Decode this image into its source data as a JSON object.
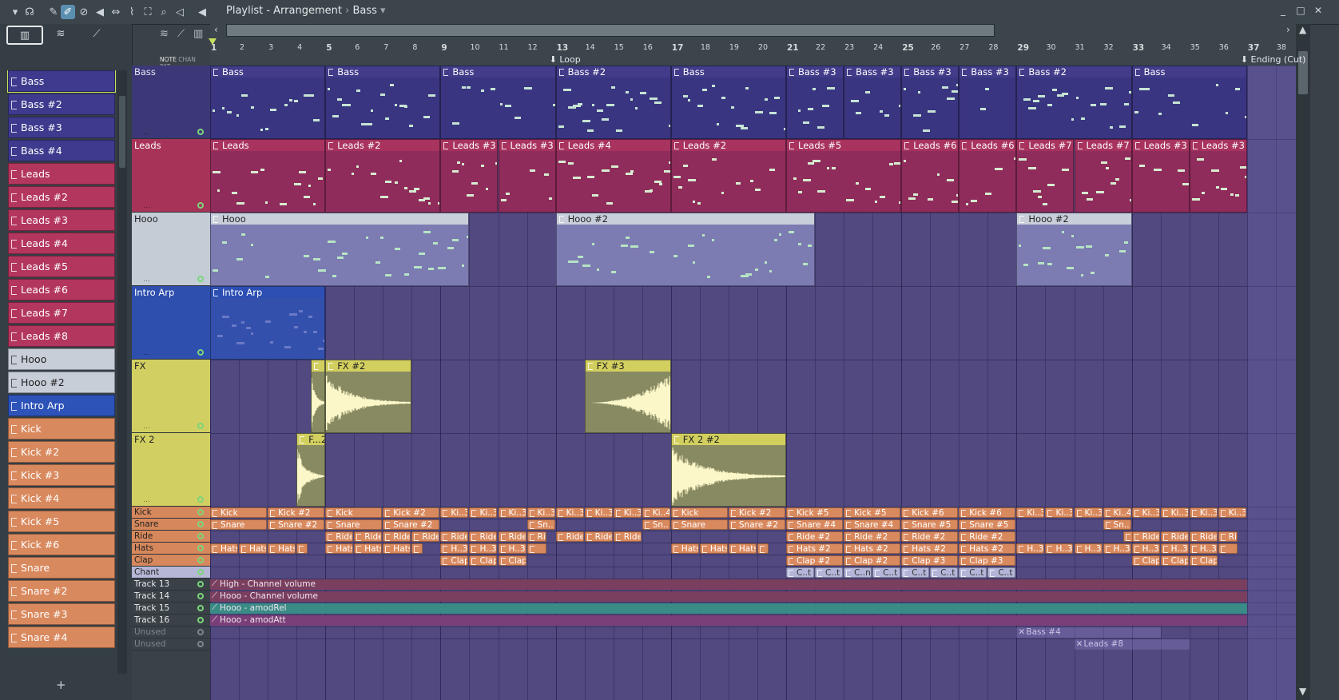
{
  "window": {
    "title": "Playlist - Arrangement",
    "pattern_selector": "Bass",
    "sep": "›"
  },
  "browser": {
    "tab_labels": [
      "NOTE",
      "CHAN",
      "PAT"
    ],
    "patterns": [
      {
        "label": "Bass",
        "color": "#3e3b8e",
        "selected": true
      },
      {
        "label": "Bass #2",
        "color": "#3e3b8e"
      },
      {
        "label": "Bass #3",
        "color": "#3e3b8e"
      },
      {
        "label": "Bass #4",
        "color": "#3e3b8e"
      },
      {
        "label": "Leads",
        "color": "#b3365f"
      },
      {
        "label": "Leads #2",
        "color": "#b3365f"
      },
      {
        "label": "Leads #3",
        "color": "#b3365f"
      },
      {
        "label": "Leads #4",
        "color": "#b3365f"
      },
      {
        "label": "Leads #5",
        "color": "#b3365f"
      },
      {
        "label": "Leads #6",
        "color": "#b3365f"
      },
      {
        "label": "Leads #7",
        "color": "#b3365f"
      },
      {
        "label": "Leads #8",
        "color": "#b3365f"
      },
      {
        "label": "Hooo",
        "color": "#c7ced8"
      },
      {
        "label": "Hooo #2",
        "color": "#c7ced8"
      },
      {
        "label": "Intro Arp",
        "color": "#2d53b8"
      },
      {
        "label": "Kick",
        "color": "#d9895e"
      },
      {
        "label": "Kick #2",
        "color": "#d9895e"
      },
      {
        "label": "Kick #3",
        "color": "#d9895e"
      },
      {
        "label": "Kick #4",
        "color": "#d9895e"
      },
      {
        "label": "Kick #5",
        "color": "#d9895e"
      },
      {
        "label": "Kick #6",
        "color": "#d9895e"
      },
      {
        "label": "Snare",
        "color": "#d9895e"
      },
      {
        "label": "Snare #2",
        "color": "#d9895e"
      },
      {
        "label": "Snare #3",
        "color": "#d9895e"
      },
      {
        "label": "Snare #4",
        "color": "#d9895e"
      }
    ]
  },
  "timeline": {
    "bars": [
      "1",
      "2",
      "3",
      "4",
      "5",
      "6",
      "7",
      "8",
      "9",
      "10",
      "11",
      "12",
      "13",
      "14",
      "15",
      "16",
      "17",
      "18",
      "19",
      "20",
      "21",
      "22",
      "23",
      "24",
      "25",
      "26",
      "27",
      "28",
      "29",
      "30",
      "31",
      "32",
      "33",
      "34",
      "35",
      "36",
      "37",
      "38"
    ],
    "markers": [
      {
        "label": "Loop",
        "bar": 13
      },
      {
        "label": "Ending (Cut)",
        "bar": 37
      }
    ]
  },
  "tracks": [
    {
      "name": "Bass",
      "color": "#3c3878",
      "text": "#e6e6f2"
    },
    {
      "name": "Leads",
      "color": "#a83358",
      "text": "#ffffff"
    },
    {
      "name": "Hooo",
      "color": "#c4ccd6",
      "text": "#222"
    },
    {
      "name": "Intro Arp",
      "color": "#2e4fae",
      "text": "#ffffff"
    },
    {
      "name": "FX",
      "color": "#d2cf62",
      "text": "#222"
    },
    {
      "name": "FX  2",
      "color": "#d2cf62",
      "text": "#222"
    },
    {
      "name": "Kick",
      "color": "#d6885c",
      "text": "#222"
    },
    {
      "name": "Snare",
      "color": "#d6885c",
      "text": "#222"
    },
    {
      "name": "Ride",
      "color": "#d6885c",
      "text": "#222"
    },
    {
      "name": "Hats",
      "color": "#d6885c",
      "text": "#222"
    },
    {
      "name": "Clap",
      "color": "#d6885c",
      "text": "#222"
    },
    {
      "name": "Chant",
      "color": "#b6b7d6",
      "text": "#222"
    },
    {
      "name": "Track 13",
      "color": "#3a4248",
      "text": "#e6e9eb"
    },
    {
      "name": "Track 14",
      "color": "#3a4248",
      "text": "#e6e9eb"
    },
    {
      "name": "Track 15",
      "color": "#3a4248",
      "text": "#e6e9eb"
    },
    {
      "name": "Track 16",
      "color": "#3a4248",
      "text": "#e6e9eb"
    },
    {
      "name": "Unused",
      "color": "#3a4248",
      "text": "#7d868b"
    },
    {
      "name": "Unused",
      "color": "#3a4248",
      "text": "#7d868b"
    }
  ],
  "clips": {
    "bass": [
      {
        "label": "Bass",
        "start": 1,
        "len": 4
      },
      {
        "label": "Bass",
        "start": 5,
        "len": 4
      },
      {
        "label": "Bass",
        "start": 9,
        "len": 4
      },
      {
        "label": "Bass #2",
        "start": 13,
        "len": 4
      },
      {
        "label": "Bass",
        "start": 17,
        "len": 4
      },
      {
        "label": "Bass #3",
        "start": 21,
        "len": 2
      },
      {
        "label": "Bass #3",
        "start": 23,
        "len": 2
      },
      {
        "label": "Bass #3",
        "start": 25,
        "len": 2
      },
      {
        "label": "Bass #3",
        "start": 27,
        "len": 2
      },
      {
        "label": "Bass #2",
        "start": 29,
        "len": 4
      },
      {
        "label": "Bass",
        "start": 33,
        "len": 4
      }
    ],
    "leads": [
      {
        "label": "Leads",
        "start": 1,
        "len": 4
      },
      {
        "label": "Leads #2",
        "start": 5,
        "len": 4
      },
      {
        "label": "Leads #3",
        "start": 9,
        "len": 2
      },
      {
        "label": "Leads #3",
        "start": 11,
        "len": 2
      },
      {
        "label": "Leads #4",
        "start": 13,
        "len": 4
      },
      {
        "label": "Leads #2",
        "start": 17,
        "len": 4
      },
      {
        "label": "Leads #5",
        "start": 21,
        "len": 4
      },
      {
        "label": "Leads #6",
        "start": 25,
        "len": 2
      },
      {
        "label": "Leads #6",
        "start": 27,
        "len": 2
      },
      {
        "label": "Leads #7",
        "start": 29,
        "len": 2
      },
      {
        "label": "Leads #7",
        "start": 31,
        "len": 2
      },
      {
        "label": "Leads #3",
        "start": 33,
        "len": 2
      },
      {
        "label": "Leads #3",
        "start": 35,
        "len": 2
      }
    ],
    "hooo": [
      {
        "label": "Hooo",
        "start": 1,
        "len": 9
      },
      {
        "label": "Hooo #2",
        "start": 13,
        "len": 9
      },
      {
        "label": "Hooo #2",
        "start": 29,
        "len": 4
      }
    ],
    "arp": [
      {
        "label": "Intro Arp",
        "start": 1,
        "len": 4
      }
    ],
    "fx": [
      {
        "label": "",
        "start": 4.5,
        "len": 0.5
      },
      {
        "label": "FX #2",
        "start": 5,
        "len": 3
      },
      {
        "label": "FX #3",
        "start": 14,
        "len": 3
      }
    ],
    "fx2": [
      {
        "label": "F...2",
        "start": 4,
        "len": 1
      },
      {
        "label": "FX  2 #2",
        "start": 17,
        "len": 4
      }
    ],
    "kick": [
      {
        "label": "Kick",
        "start": 1,
        "len": 2
      },
      {
        "label": "Kick #2",
        "start": 3,
        "len": 2
      },
      {
        "label": "Kick",
        "start": 5,
        "len": 2
      },
      {
        "label": "Kick #2",
        "start": 7,
        "len": 2
      },
      {
        "label": "Ki..3",
        "start": 9,
        "len": 1
      },
      {
        "label": "Ki..3",
        "start": 10,
        "len": 1
      },
      {
        "label": "Ki..3",
        "start": 11,
        "len": 1
      },
      {
        "label": "Ki..3",
        "start": 12,
        "len": 1
      },
      {
        "label": "Ki..3",
        "start": 13,
        "len": 1
      },
      {
        "label": "Ki..3",
        "start": 14,
        "len": 1
      },
      {
        "label": "Ki..3",
        "start": 15,
        "len": 1
      },
      {
        "label": "Ki..4",
        "start": 16,
        "len": 1
      },
      {
        "label": "Kick",
        "start": 17,
        "len": 2
      },
      {
        "label": "Kick #2",
        "start": 19,
        "len": 2
      },
      {
        "label": "Kick #5",
        "start": 21,
        "len": 2
      },
      {
        "label": "Kick #5",
        "start": 23,
        "len": 2
      },
      {
        "label": "Kick #6",
        "start": 25,
        "len": 2
      },
      {
        "label": "Kick #6",
        "start": 27,
        "len": 2
      },
      {
        "label": "Ki..3",
        "start": 29,
        "len": 1
      },
      {
        "label": "Ki..3",
        "start": 30,
        "len": 1
      },
      {
        "label": "Ki..3",
        "start": 31,
        "len": 1
      },
      {
        "label": "Ki..4",
        "start": 32,
        "len": 1
      },
      {
        "label": "Ki..3",
        "start": 33,
        "len": 1
      },
      {
        "label": "Ki..3",
        "start": 34,
        "len": 1
      },
      {
        "label": "Ki..3",
        "start": 35,
        "len": 1
      },
      {
        "label": "Ki..3",
        "start": 36,
        "len": 1
      }
    ],
    "snare": [
      {
        "label": "Snare",
        "start": 1,
        "len": 2
      },
      {
        "label": "Snare #2",
        "start": 3,
        "len": 2
      },
      {
        "label": "Snare",
        "start": 5,
        "len": 2
      },
      {
        "label": "Snare #2",
        "start": 7,
        "len": 2
      },
      {
        "label": "Sn..",
        "start": 12,
        "len": 1
      },
      {
        "label": "Sn..",
        "start": 16,
        "len": 1
      },
      {
        "label": "Snare",
        "start": 17,
        "len": 2
      },
      {
        "label": "Snare #2",
        "start": 19,
        "len": 2
      },
      {
        "label": "Snare #4",
        "start": 21,
        "len": 2
      },
      {
        "label": "Snare #4",
        "start": 23,
        "len": 2
      },
      {
        "label": "Snare #5",
        "start": 25,
        "len": 2
      },
      {
        "label": "Snare #5",
        "start": 27,
        "len": 2
      },
      {
        "label": "Sn..",
        "start": 32,
        "len": 1
      }
    ],
    "ride": [
      {
        "label": "Ride",
        "start": 5,
        "len": 1
      },
      {
        "label": "Ride",
        "start": 6,
        "len": 1
      },
      {
        "label": "Ride",
        "start": 7,
        "len": 1
      },
      {
        "label": "Ride",
        "start": 8,
        "len": 1
      },
      {
        "label": "Ride",
        "start": 9,
        "len": 1
      },
      {
        "label": "Ride",
        "start": 10,
        "len": 1
      },
      {
        "label": "Ride",
        "start": 11,
        "len": 1
      },
      {
        "label": "Ride",
        "start": 12,
        "len": 0.7
      },
      {
        "label": "Ride",
        "start": 13,
        "len": 1
      },
      {
        "label": "Ride",
        "start": 14,
        "len": 1
      },
      {
        "label": "Ride",
        "start": 15,
        "len": 1
      },
      {
        "label": "Ride #2",
        "start": 21,
        "len": 2
      },
      {
        "label": "Ride #2",
        "start": 23,
        "len": 2
      },
      {
        "label": "Ride #2",
        "start": 25,
        "len": 2
      },
      {
        "label": "Ride #2",
        "start": 27,
        "len": 2
      },
      {
        "label": "Ride",
        "start": 32.7,
        "len": 0.3
      },
      {
        "label": "Ride",
        "start": 33,
        "len": 1
      },
      {
        "label": "Ride",
        "start": 34,
        "len": 1
      },
      {
        "label": "Ride",
        "start": 35,
        "len": 1
      },
      {
        "label": "Ride",
        "start": 36,
        "len": 0.7
      }
    ],
    "hats": [
      {
        "label": "Hats",
        "start": 1,
        "len": 1
      },
      {
        "label": "Hats",
        "start": 2,
        "len": 1
      },
      {
        "label": "Hats",
        "start": 3,
        "len": 1
      },
      {
        "label": "",
        "start": 4,
        "len": 0.4
      },
      {
        "label": "Hats",
        "start": 5,
        "len": 1
      },
      {
        "label": "Hats",
        "start": 6,
        "len": 1
      },
      {
        "label": "Hats",
        "start": 7,
        "len": 1
      },
      {
        "label": "",
        "start": 8,
        "len": 0.4
      },
      {
        "label": "H..3",
        "start": 9,
        "len": 1
      },
      {
        "label": "H..3",
        "start": 10,
        "len": 1
      },
      {
        "label": "H..3",
        "start": 11,
        "len": 1
      },
      {
        "label": "",
        "start": 12,
        "len": 0.7
      },
      {
        "label": "Hats",
        "start": 17,
        "len": 1
      },
      {
        "label": "Hats",
        "start": 18,
        "len": 1
      },
      {
        "label": "Hats",
        "start": 19,
        "len": 1
      },
      {
        "label": "",
        "start": 20,
        "len": 0.4
      },
      {
        "label": "Hats #2",
        "start": 21,
        "len": 2
      },
      {
        "label": "Hats #2",
        "start": 23,
        "len": 2
      },
      {
        "label": "Hats #2",
        "start": 25,
        "len": 2
      },
      {
        "label": "Hats #2",
        "start": 27,
        "len": 2
      },
      {
        "label": "H..3",
        "start": 29,
        "len": 1
      },
      {
        "label": "H..3",
        "start": 30,
        "len": 1
      },
      {
        "label": "H..3",
        "start": 31,
        "len": 1
      },
      {
        "label": "H..3",
        "start": 32,
        "len": 1
      },
      {
        "label": "H..3",
        "start": 33,
        "len": 1
      },
      {
        "label": "H..3",
        "start": 34,
        "len": 1
      },
      {
        "label": "H..3",
        "start": 35,
        "len": 1
      },
      {
        "label": "",
        "start": 36,
        "len": 0.7
      }
    ],
    "clap": [
      {
        "label": "Clap",
        "start": 9,
        "len": 1
      },
      {
        "label": "Clap",
        "start": 10,
        "len": 1
      },
      {
        "label": "Clap",
        "start": 11,
        "len": 1
      },
      {
        "label": "Clap #2",
        "start": 21,
        "len": 2
      },
      {
        "label": "Clap #2",
        "start": 23,
        "len": 2
      },
      {
        "label": "Clap #3",
        "start": 25,
        "len": 2
      },
      {
        "label": "Clap #3",
        "start": 27,
        "len": 2
      },
      {
        "label": "Clap",
        "start": 33,
        "len": 1
      },
      {
        "label": "Clap",
        "start": 34,
        "len": 1
      },
      {
        "label": "Clap",
        "start": 35,
        "len": 1
      }
    ],
    "chant": [
      {
        "label": "C..t",
        "start": 21,
        "len": 1
      },
      {
        "label": "C..t",
        "start": 22,
        "len": 1
      },
      {
        "label": "C..nt",
        "start": 23,
        "len": 1
      },
      {
        "label": "C..t",
        "start": 24,
        "len": 1
      },
      {
        "label": "C..t",
        "start": 25,
        "len": 1
      },
      {
        "label": "C..t",
        "start": 26,
        "len": 1
      },
      {
        "label": "C..t",
        "start": 27,
        "len": 1
      },
      {
        "label": "C..t",
        "start": 28,
        "len": 1
      }
    ],
    "automation": [
      {
        "label": "High - Channel volume",
        "color": "#7a3f5f"
      },
      {
        "label": "Hooo - Channel volume",
        "color": "#7a3f5f"
      },
      {
        "label": "Hooo - amodRel",
        "color": "#3a8a86"
      },
      {
        "label": "Hooo - amodAtt",
        "color": "#7a3f78"
      }
    ],
    "unused": [
      {
        "label": "Bass #4",
        "start": 29,
        "len": 5
      },
      {
        "label": "Leads #8",
        "start": 31,
        "len": 4
      }
    ]
  }
}
